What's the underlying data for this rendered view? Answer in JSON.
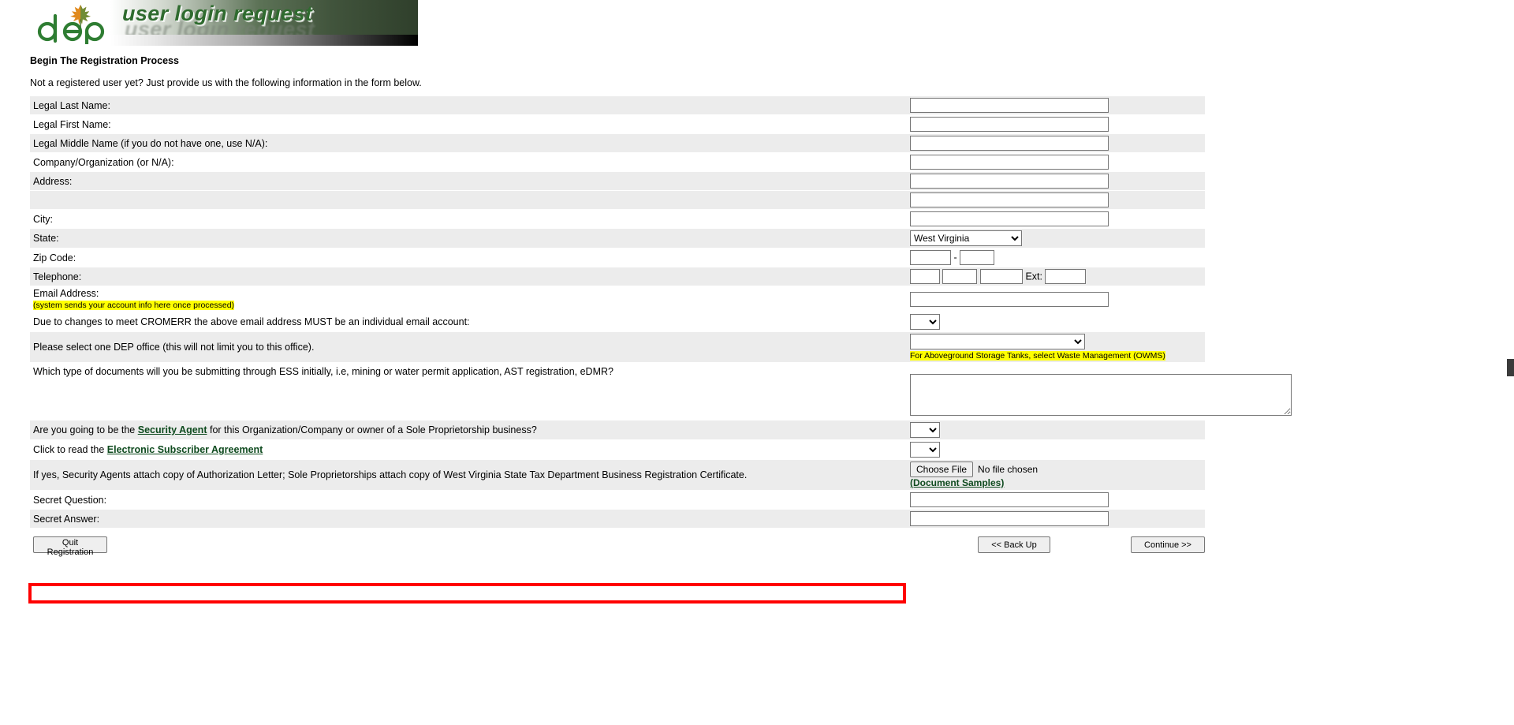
{
  "header": {
    "logo_alt": "dep",
    "banner_title": "user login request"
  },
  "page": {
    "section_title": "Begin The Registration Process",
    "intro": "Not a registered user yet? Just provide us with the following information in the form below."
  },
  "form": {
    "labels": {
      "last_name": "Legal Last Name:",
      "first_name": "Legal First Name:",
      "middle_name": "Legal Middle Name (if you do not have one, use N/A):",
      "company": "Company/Organization (or N/A):",
      "address": "Address:",
      "address2": "",
      "city": "City:",
      "state": "State:",
      "zip": "Zip Code:",
      "telephone": "Telephone:",
      "email": "Email Address:",
      "email_note": "(system sends your account info here once processed)",
      "cromerr": "Due to changes to meet CROMERR the above email address MUST be an individual email account:",
      "dep_office": "Please select one DEP office (this will not limit you to this office).",
      "doc_types": "Which type of documents will you be submitting through ESS initially, i.e, mining or water permit application, AST registration, eDMR?",
      "security_agent_pre": "Are you going to be the ",
      "security_agent_link": "Security Agent",
      "security_agent_post": " for this Organization/Company or owner of a Sole Proprietorship business?",
      "esa_pre": "Click to read the ",
      "esa_link": "Electronic Subscriber Agreement",
      "attach": "If yes, Security Agents attach copy of Authorization Letter; Sole Proprietorships attach copy of West Virginia State Tax Department Business Registration Certificate.",
      "secret_question": "Secret Question:",
      "secret_answer": "Secret Answer:",
      "ext": "Ext:",
      "zip_dash": "-"
    },
    "values": {
      "last_name": "",
      "first_name": "",
      "middle_name": "",
      "company": "",
      "address": "",
      "address2": "",
      "city": "",
      "state": "West Virginia",
      "zip1": "",
      "zip2": "",
      "tel1": "",
      "tel2": "",
      "tel3": "",
      "ext": "",
      "email": "",
      "cromerr": "",
      "dep_office": "",
      "doc_types": "",
      "security_agent": "",
      "esa": "",
      "secret_question": "",
      "secret_answer": ""
    },
    "office_note": "For Aboveground Storage Tanks, select Waste Management (OWMS)",
    "file_upload": {
      "button_label": "Choose File",
      "no_file_text": "No file chosen",
      "samples_link": "(Document Samples)"
    }
  },
  "buttons": {
    "quit": "Quit Registration",
    "back": "<< Back Up",
    "continue": "Continue >>"
  },
  "colors": {
    "link": "#0e4a1e",
    "highlight": "#ffff00",
    "red_box": "#ff0000",
    "row_alt": "#ececec"
  }
}
